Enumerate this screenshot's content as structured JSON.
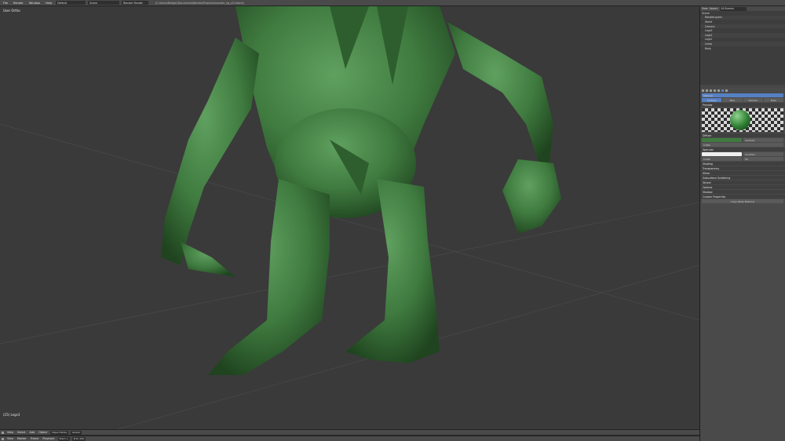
{
  "topbar": {
    "menus": [
      "File",
      "Render",
      "Window",
      "Help"
    ],
    "layout": "Default",
    "scene": "Scene",
    "engine": "Blender Render",
    "path": "[C:\\Users\\Bridger\\Documents\\Blender\\Projects\\monster_rig_v12.blend]"
  },
  "viewport": {
    "label": "User Ortho",
    "object_label": "(25) Legs3"
  },
  "bottombar": {
    "row1": [
      "View",
      "Select",
      "Add",
      "Object",
      "Object Mode",
      "Global"
    ],
    "row2": [
      "View",
      "Marker",
      "Frame",
      "Playback",
      "Start: 1",
      "End: 250"
    ]
  },
  "outliner": {
    "header": [
      "View",
      "Search",
      "All Scenes"
    ],
    "items": [
      "Scene",
      "RenderLayers",
      "World",
      "Camera",
      "Legs3",
      "Legs2",
      "Legs1",
      "Lamp",
      "Body"
    ]
  },
  "properties": {
    "material_name": "Material",
    "tabs": [
      "Surface",
      "Wire",
      "Volume",
      "Halo"
    ],
    "panels": [
      "Preview",
      "Diffuse",
      "Specular",
      "Shading",
      "Transparency",
      "Mirror",
      "Subsurface Scattering",
      "Strand",
      "Options",
      "Shadow",
      "Custom Properties"
    ],
    "diffuse_shader": "Lambert",
    "intensity": "0.800",
    "specular_shader": "CookTorr",
    "specular_intensity": "0.500",
    "hardness": "50",
    "bottom_button": "Copy Paste Material"
  },
  "colors": {
    "accent": "#5680c2",
    "monster": "#3f7a3f",
    "viewport": "#3a3a3a"
  }
}
